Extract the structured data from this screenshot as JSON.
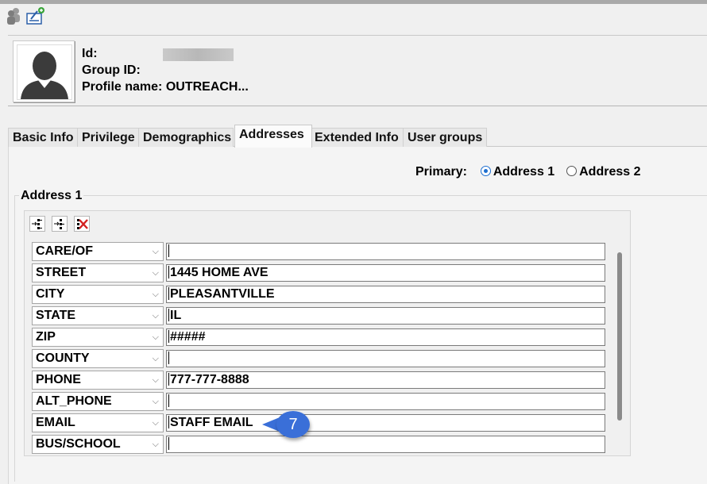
{
  "profile": {
    "id_label": "Id:",
    "group_id_label": "Group ID:",
    "profile_name_label": "Profile name:",
    "profile_name_value": "OUTREACH..."
  },
  "tabs": [
    {
      "label": "Basic Info"
    },
    {
      "label": "Privilege"
    },
    {
      "label": "Demographics"
    },
    {
      "label": "Addresses",
      "active": true
    },
    {
      "label": "Extended Info"
    },
    {
      "label": "User groups"
    }
  ],
  "primary": {
    "label": "Primary:",
    "options": [
      {
        "label": "Address 1",
        "selected": true
      },
      {
        "label": "Address 2",
        "selected": false
      }
    ]
  },
  "address_group": {
    "title": "Address 1",
    "rows": [
      {
        "field": "CARE/OF",
        "value": ""
      },
      {
        "field": "STREET",
        "value": "1445 HOME AVE"
      },
      {
        "field": "CITY",
        "value": "PLEASANTVILLE"
      },
      {
        "field": "STATE",
        "value": "IL"
      },
      {
        "field": "ZIP",
        "value": "#####"
      },
      {
        "field": "COUNTY",
        "value": ""
      },
      {
        "field": "PHONE",
        "value": "777-777-8888"
      },
      {
        "field": "ALT_PHONE",
        "value": ""
      },
      {
        "field": "EMAIL",
        "value": "STAFF EMAIL"
      },
      {
        "field": "BUS/SCHOOL",
        "value": ""
      }
    ]
  },
  "callout": {
    "number": "7",
    "color": "#3a6fd8"
  },
  "colors": {
    "accent": "#1e6fd0",
    "delete_red": "#d21f1f"
  }
}
